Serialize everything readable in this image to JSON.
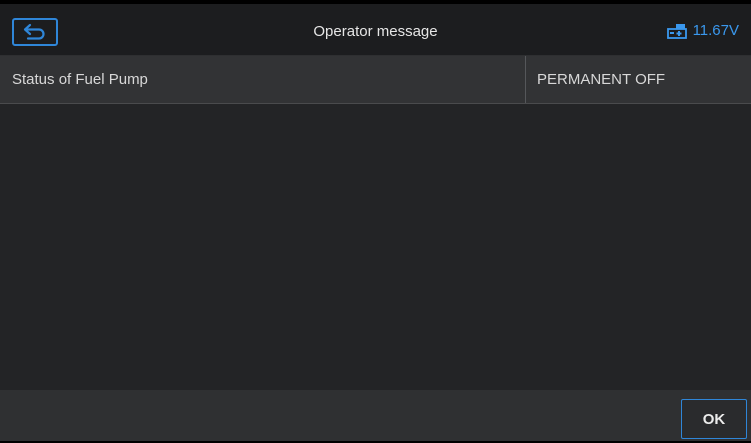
{
  "header": {
    "title": "Operator message",
    "back_icon": "back-arrow-icon",
    "battery_icon": "vehicle-battery-icon",
    "voltage": "11.67V"
  },
  "row": {
    "name": "Status of Fuel Pump",
    "value": "PERMANENT OFF"
  },
  "footer": {
    "ok_label": "OK"
  },
  "colors": {
    "accent": "#2f86d8",
    "voltage": "#3a98ee",
    "background": "#232426",
    "header": "#1c1d1f",
    "row": "#323335",
    "footer": "#2f3032"
  }
}
